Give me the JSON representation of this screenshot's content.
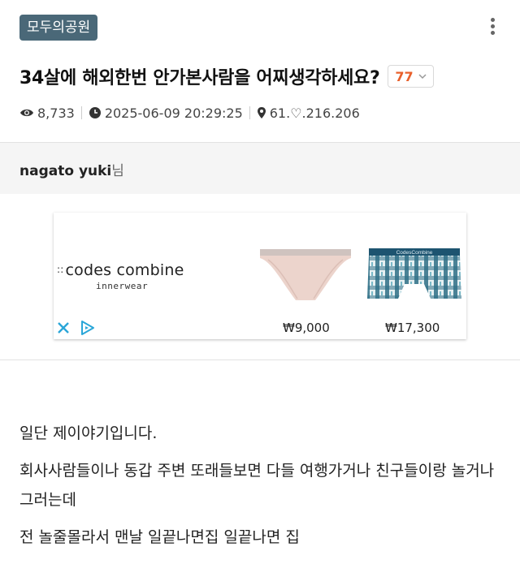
{
  "header": {
    "board_name": "모두의공원",
    "title": "34살에 해외한번 안가본사람을 어찌생각하세요?",
    "comment_count": "77"
  },
  "meta": {
    "views": "8,733",
    "datetime": "2025-06-09 20:29:25",
    "ip": "61.♡.216.206"
  },
  "author": {
    "name": "nagato yuki",
    "suffix": "님"
  },
  "ad": {
    "brand_dots": "::",
    "brand": "codes combine",
    "brand_sub": "innerwear",
    "product1_price": "₩9,000",
    "product2_price": "₩17,300",
    "product2_waistband": "CodesCombine"
  },
  "post": {
    "paragraphs": [
      "일단 제이야기입니다.",
      "회사사람들이나 동갑 주변 또래들보면 다들 여행가거나 친구들이랑 놀거나그러는데",
      "전 놀줄몰라서 맨날 일끝나면집 일끝나면 집"
    ]
  },
  "colors": {
    "badge_bg": "#4a6878",
    "comment_count": "#e8602c",
    "ad_icons": "#2aa6d8"
  },
  "icons": {
    "views": "eye-icon",
    "datetime": "clock-icon",
    "ip": "location-pin-icon",
    "menu": "kebab-menu-icon",
    "dropdown": "chevron-down-icon"
  }
}
